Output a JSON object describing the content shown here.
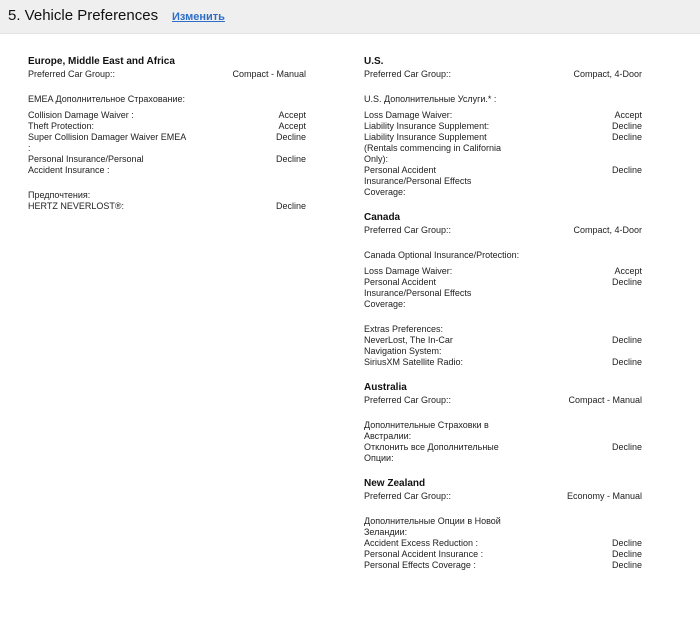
{
  "header": {
    "title": "5. Vehicle Preferences",
    "edit_link": "Изменить"
  },
  "emea": {
    "title": "Europe, Middle East and Africa",
    "car_group_label": "Preferred Car Group::",
    "car_group_value": "Compact - Manual",
    "insurance_heading": "EMEA Дополнительное Страхование:",
    "insurance": [
      {
        "label": "Collision Damage Waiver :",
        "value": "Accept"
      },
      {
        "label": "Theft Protection:",
        "value": "Accept"
      },
      {
        "label": "Super Collision Damager Waiver EMEA :",
        "value": "Decline"
      },
      {
        "label": "Personal Insurance/Personal Accident Insurance :",
        "value": "Decline"
      }
    ],
    "prefs_heading": "Предпочтения:",
    "prefs": [
      {
        "label": "HERTZ NEVERLOST®:",
        "value": "Decline"
      }
    ]
  },
  "us": {
    "title": "U.S.",
    "car_group_label": "Preferred Car Group::",
    "car_group_value": "Compact, 4-Door",
    "services_heading": "U.S. Дополнительные Услуги.* :",
    "services": [
      {
        "label": "Loss Damage Waiver:",
        "value": "Accept"
      },
      {
        "label": "Liability Insurance Supplement:",
        "value": "Decline"
      },
      {
        "label": "Liability Insurance Supplement (Rentals commencing in California Only):",
        "value": "Decline"
      },
      {
        "label": "Personal Accident Insurance/Personal Effects Coverage:",
        "value": "Decline"
      }
    ]
  },
  "canada": {
    "title": "Canada",
    "car_group_label": "Preferred Car Group::",
    "car_group_value": "Compact, 4-Door",
    "insurance_heading": "Canada Optional Insurance/Protection:",
    "insurance": [
      {
        "label": "Loss Damage Waiver:",
        "value": "Accept"
      },
      {
        "label": "Personal Accident Insurance/Personal Effects Coverage:",
        "value": "Decline"
      }
    ],
    "extras_heading": "Extras Preferences:",
    "extras": [
      {
        "label": "NeverLost, The In-Car Navigation System:",
        "value": "Decline"
      },
      {
        "label": "SiriusXM Satellite Radio:",
        "value": "Decline"
      }
    ]
  },
  "australia": {
    "title": "Australia",
    "car_group_label": "Preferred Car Group::",
    "car_group_value": "Compact - Manual",
    "insurance_heading": "Дополнительные Страховки в Австралии:",
    "insurance": [
      {
        "label": "Отклонить все Дополнительные Опции:",
        "value": "Decline"
      }
    ]
  },
  "new_zealand": {
    "title": "New Zealand",
    "car_group_label": "Preferred Car Group::",
    "car_group_value": "Economy - Manual",
    "options_heading": "Дополнительные Опции в Новой Зеландии:",
    "options": [
      {
        "label": "Accident Excess Reduction :",
        "value": "Decline"
      },
      {
        "label": "Personal Accident Insurance :",
        "value": "Decline"
      },
      {
        "label": "Personal Effects Coverage :",
        "value": "Decline"
      }
    ]
  }
}
